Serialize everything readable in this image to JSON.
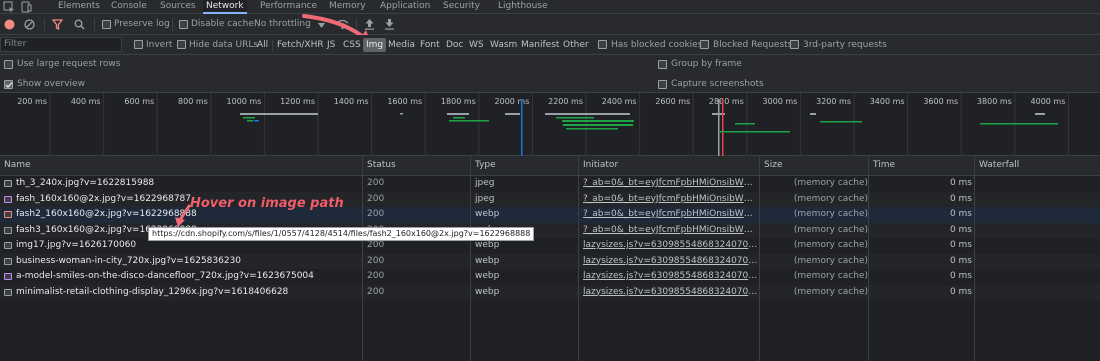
{
  "tabs": [
    "Elements",
    "Console",
    "Sources",
    "Network",
    "Performance",
    "Memory",
    "Application",
    "Security",
    "Lighthouse"
  ],
  "active_tab": "Network",
  "toolbar": {
    "preserve_log": "Preserve log",
    "disable_cache": "Disable cache",
    "throttling": "No throttling"
  },
  "filter": {
    "placeholder": "Filter",
    "invert": "Invert",
    "hide_data_urls": "Hide data URLs",
    "types": [
      "All",
      "Fetch/XHR",
      "JS",
      "CSS",
      "Img",
      "Media",
      "Font",
      "Doc",
      "WS",
      "Wasm",
      "Manifest",
      "Other"
    ],
    "selected_type": "Img",
    "has_blocked_cookies": "Has blocked cookies",
    "blocked_requests": "Blocked Requests",
    "third_party": "3rd-party requests"
  },
  "settings": {
    "large_rows": "Use large request rows",
    "show_overview": "Show overview",
    "group_by_frame": "Group by frame",
    "capture_screenshots": "Capture screenshots"
  },
  "timeline": {
    "ticks": [
      "200 ms",
      "400 ms",
      "600 ms",
      "800 ms",
      "1000 ms",
      "1200 ms",
      "1400 ms",
      "1600 ms",
      "1800 ms",
      "2000 ms",
      "2200 ms",
      "2400 ms",
      "2600 ms",
      "2800 ms",
      "3000 ms",
      "3200 ms",
      "3400 ms",
      "3600 ms",
      "3800 ms",
      "4000 ms"
    ]
  },
  "table": {
    "headers": {
      "name": "Name",
      "status": "Status",
      "type": "Type",
      "initiator": "Initiator",
      "size": "Size",
      "time": "Time",
      "waterfall": "Waterfall"
    },
    "rows": [
      {
        "name": "th_3_240x.jpg?v=1622815988",
        "status": "200",
        "type": "jpeg",
        "initiator": "?_ab=0&_bt=eyJfcmFpbHMiOnsibWVzc2F...",
        "size": "(memory cache)",
        "time": "0 ms"
      },
      {
        "name": "fash_160x160@2x.jpg?v=1622968787",
        "status": "200",
        "type": "jpeg",
        "initiator": "?_ab=0&_bt=eyJfcmFpbHMiOnsibWVzc2F...",
        "size": "(memory cache)",
        "time": "0 ms"
      },
      {
        "name": "fash2_160x160@2x.jpg?v=1622968888",
        "status": "200",
        "type": "webp",
        "initiator": "?_ab=0&_bt=eyJfcmFpbHMiOnsibWVzc2F...",
        "size": "(memory cache)",
        "time": "0 ms"
      },
      {
        "name": "fash3_160x160@2x.jpg?v=1622968888",
        "status": "200",
        "type": "webp",
        "initiator": "?_ab=0&_bt=eyJfcmFpbHMiOnsibWVzc2F...",
        "size": "(memory cache)",
        "time": "0 ms"
      },
      {
        "name": "img17.jpg?v=1626170060",
        "status": "200",
        "type": "webp",
        "initiator": "lazysizes.js?v=630985548683240701 3?_c2...",
        "size": "(memory cache)",
        "time": "0 ms"
      },
      {
        "name": "business-woman-in-city_720x.jpg?v=1625836230",
        "status": "200",
        "type": "webp",
        "initiator": "lazysizes.js?v=6309855486832407013?_c2...",
        "size": "(memory cache)",
        "time": "0 ms"
      },
      {
        "name": "a-model-smiles-on-the-disco-dancefloor_720x.jpg?v=1623675004",
        "status": "200",
        "type": "webp",
        "initiator": "lazysizes.js?v=6309855486832407013?_c2...",
        "size": "(memory cache)",
        "time": "0 ms"
      },
      {
        "name": "minimalist-retail-clothing-display_1296x.jpg?v=1618406628",
        "status": "200",
        "type": "webp",
        "initiator": "lazysizes.js?v=6309855486832407013?_c2...",
        "size": "(memory cache)",
        "time": "0 ms"
      }
    ]
  },
  "tooltip": "https://cdn.shopify.com/s/files/1/0557/4128/4514/files/fash2_160x160@2x.jpg?v=1622968888",
  "annotation": "Hover on image path",
  "colors": {
    "accent": "#8ab4f8",
    "record": "#f28b82",
    "filter_active": "#f28b82",
    "annotation": "#ef5d6c",
    "waterfall_green": "#1ea446",
    "waterfall_blue": "#1a73e8"
  }
}
